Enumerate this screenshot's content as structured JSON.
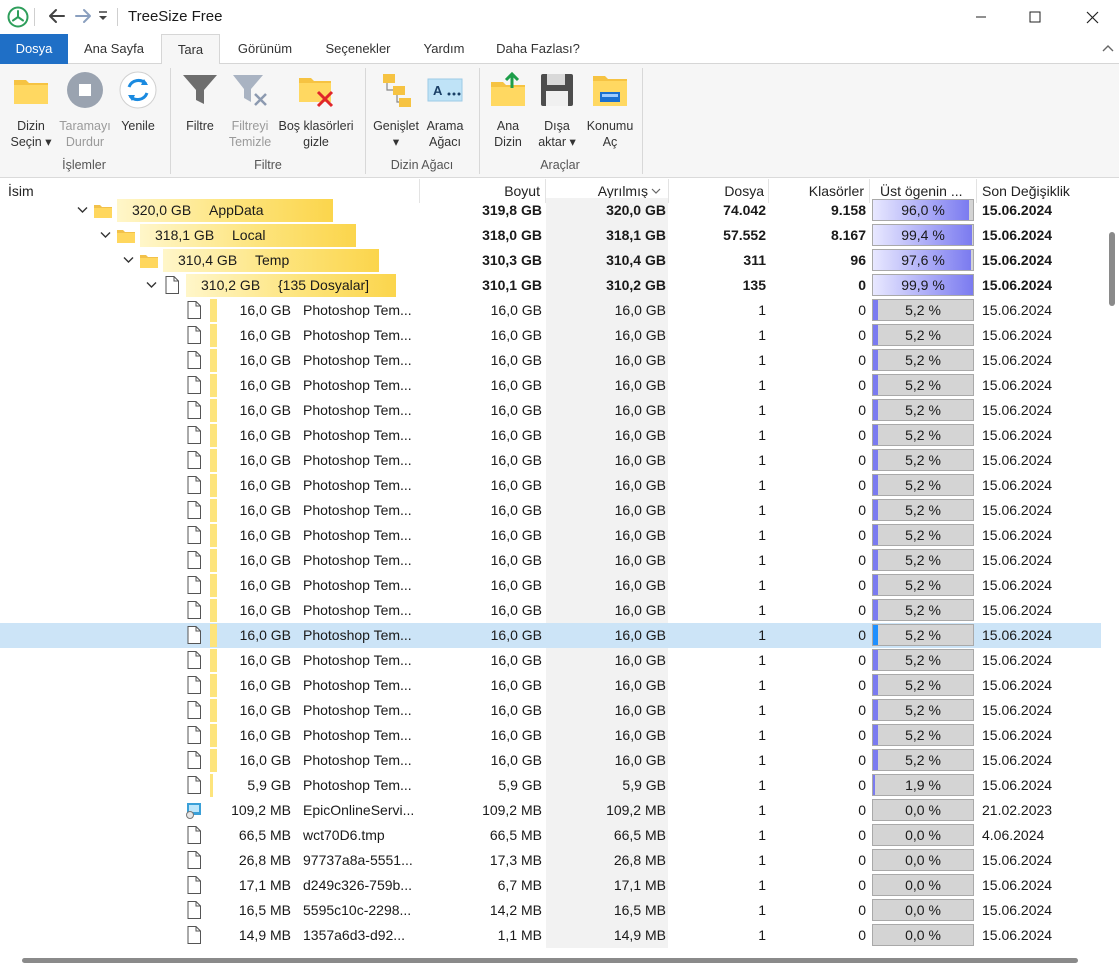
{
  "window": {
    "title": "TreeSize Free"
  },
  "ribbon_tabs": [
    "Dosya",
    "Ana Sayfa",
    "Tara",
    "Görünüm",
    "Seçenekler",
    "Yardım",
    "Daha Fazlası?"
  ],
  "ribbon": {
    "buttons": [
      {
        "label1": "Dizin",
        "label2": "Seçin ▾",
        "icon": "folder-open-icon"
      },
      {
        "label1": "Taramayı",
        "label2": "Durdur",
        "icon": "stop-icon"
      },
      {
        "label1": "Yenile",
        "label2": "",
        "icon": "refresh-icon"
      },
      {
        "label1": "Filtre",
        "label2": "",
        "icon": "filter-icon"
      },
      {
        "label1": "Filtreyi",
        "label2": "Temizle",
        "icon": "clear-filter-icon"
      },
      {
        "label1": "Boş klasörleri",
        "label2": "gizle",
        "icon": "hide-empty-folders-icon"
      },
      {
        "label1": "Genişlet",
        "label2": "▾",
        "icon": "expand-tree-icon"
      },
      {
        "label1": "Arama",
        "label2": "Ağacı",
        "icon": "search-tree-icon"
      },
      {
        "label1": "Ana",
        "label2": "Dizin",
        "icon": "parent-folder-icon"
      },
      {
        "label1": "Dışa",
        "label2": "aktar ▾",
        "icon": "save-export-icon"
      },
      {
        "label1": "Konumu",
        "label2": "Aç",
        "icon": "open-location-icon"
      }
    ],
    "groups": [
      "İşlemler",
      "Filtre",
      "Dizin Ağacı",
      "Araçlar"
    ]
  },
  "columns": [
    "İsim",
    "Boyut",
    "Ayrılmış",
    "Dosya",
    "Klasörler",
    "Üst ögenin ...",
    "Son Değişiklik"
  ],
  "colors": {
    "accent": "#1f6fc6",
    "folder_bar": "#fde47c",
    "percent_fill": "#7b7bf0",
    "percent_fill_selected": "#1e90ff",
    "selected_row": "#cce4f7"
  },
  "tree_rows": [
    {
      "name_size": "320,0 GB",
      "name": "AppData",
      "size": "319,8 GB",
      "alloc": "320,0 GB",
      "files": "74.042",
      "folders": "9.158",
      "pct": "96,0 %",
      "pct_value": 96.0,
      "date": "15.06.2024",
      "kind": "folder",
      "level": 0,
      "bold": true
    },
    {
      "name_size": "318,1 GB",
      "name": "Local",
      "size": "318,0 GB",
      "alloc": "318,1 GB",
      "files": "57.552",
      "folders": "8.167",
      "pct": "99,4 %",
      "pct_value": 99.4,
      "date": "15.06.2024",
      "kind": "folder",
      "level": 1,
      "bold": true
    },
    {
      "name_size": "310,4 GB",
      "name": "Temp",
      "size": "310,3 GB",
      "alloc": "310,4 GB",
      "files": "311",
      "folders": "96",
      "pct": "97,6 %",
      "pct_value": 97.6,
      "date": "15.06.2024",
      "kind": "folder",
      "level": 2,
      "bold": true
    },
    {
      "name_size": "310,2 GB",
      "name": "{135 Dosyalar]",
      "size": "310,1 GB",
      "alloc": "310,2 GB",
      "files": "135",
      "folders": "0",
      "pct": "99,9 %",
      "pct_value": 99.9,
      "date": "15.06.2024",
      "kind": "files-group",
      "level": 3,
      "bold": true
    }
  ],
  "file_rows": [
    {
      "name_size": "16,0 GB",
      "name": "Photoshop Tem...",
      "size": "16,0 GB",
      "alloc": "16,0 GB",
      "files": "1",
      "folders": "0",
      "pct": "5,2 %",
      "pct_value": 5.2,
      "date": "15.06.2024"
    },
    {
      "name_size": "16,0 GB",
      "name": "Photoshop Tem...",
      "size": "16,0 GB",
      "alloc": "16,0 GB",
      "files": "1",
      "folders": "0",
      "pct": "5,2 %",
      "pct_value": 5.2,
      "date": "15.06.2024"
    },
    {
      "name_size": "16,0 GB",
      "name": "Photoshop Tem...",
      "size": "16,0 GB",
      "alloc": "16,0 GB",
      "files": "1",
      "folders": "0",
      "pct": "5,2 %",
      "pct_value": 5.2,
      "date": "15.06.2024"
    },
    {
      "name_size": "16,0 GB",
      "name": "Photoshop Tem...",
      "size": "16,0 GB",
      "alloc": "16,0 GB",
      "files": "1",
      "folders": "0",
      "pct": "5,2 %",
      "pct_value": 5.2,
      "date": "15.06.2024"
    },
    {
      "name_size": "16,0 GB",
      "name": "Photoshop Tem...",
      "size": "16,0 GB",
      "alloc": "16,0 GB",
      "files": "1",
      "folders": "0",
      "pct": "5,2 %",
      "pct_value": 5.2,
      "date": "15.06.2024"
    },
    {
      "name_size": "16,0 GB",
      "name": "Photoshop Tem...",
      "size": "16,0 GB",
      "alloc": "16,0 GB",
      "files": "1",
      "folders": "0",
      "pct": "5,2 %",
      "pct_value": 5.2,
      "date": "15.06.2024"
    },
    {
      "name_size": "16,0 GB",
      "name": "Photoshop Tem...",
      "size": "16,0 GB",
      "alloc": "16,0 GB",
      "files": "1",
      "folders": "0",
      "pct": "5,2 %",
      "pct_value": 5.2,
      "date": "15.06.2024"
    },
    {
      "name_size": "16,0 GB",
      "name": "Photoshop Tem...",
      "size": "16,0 GB",
      "alloc": "16,0 GB",
      "files": "1",
      "folders": "0",
      "pct": "5,2 %",
      "pct_value": 5.2,
      "date": "15.06.2024"
    },
    {
      "name_size": "16,0 GB",
      "name": "Photoshop Tem...",
      "size": "16,0 GB",
      "alloc": "16,0 GB",
      "files": "1",
      "folders": "0",
      "pct": "5,2 %",
      "pct_value": 5.2,
      "date": "15.06.2024"
    },
    {
      "name_size": "16,0 GB",
      "name": "Photoshop Tem...",
      "size": "16,0 GB",
      "alloc": "16,0 GB",
      "files": "1",
      "folders": "0",
      "pct": "5,2 %",
      "pct_value": 5.2,
      "date": "15.06.2024"
    },
    {
      "name_size": "16,0 GB",
      "name": "Photoshop Tem...",
      "size": "16,0 GB",
      "alloc": "16,0 GB",
      "files": "1",
      "folders": "0",
      "pct": "5,2 %",
      "pct_value": 5.2,
      "date": "15.06.2024"
    },
    {
      "name_size": "16,0 GB",
      "name": "Photoshop Tem...",
      "size": "16,0 GB",
      "alloc": "16,0 GB",
      "files": "1",
      "folders": "0",
      "pct": "5,2 %",
      "pct_value": 5.2,
      "date": "15.06.2024"
    },
    {
      "name_size": "16,0 GB",
      "name": "Photoshop Tem...",
      "size": "16,0 GB",
      "alloc": "16,0 GB",
      "files": "1",
      "folders": "0",
      "pct": "5,2 %",
      "pct_value": 5.2,
      "date": "15.06.2024"
    },
    {
      "name_size": "16,0 GB",
      "name": "Photoshop Tem...",
      "size": "16,0 GB",
      "alloc": "16,0 GB",
      "files": "1",
      "folders": "0",
      "pct": "5,2 %",
      "pct_value": 5.2,
      "date": "15.06.2024",
      "selected": true
    },
    {
      "name_size": "16,0 GB",
      "name": "Photoshop Tem...",
      "size": "16,0 GB",
      "alloc": "16,0 GB",
      "files": "1",
      "folders": "0",
      "pct": "5,2 %",
      "pct_value": 5.2,
      "date": "15.06.2024"
    },
    {
      "name_size": "16,0 GB",
      "name": "Photoshop Tem...",
      "size": "16,0 GB",
      "alloc": "16,0 GB",
      "files": "1",
      "folders": "0",
      "pct": "5,2 %",
      "pct_value": 5.2,
      "date": "15.06.2024"
    },
    {
      "name_size": "16,0 GB",
      "name": "Photoshop Tem...",
      "size": "16,0 GB",
      "alloc": "16,0 GB",
      "files": "1",
      "folders": "0",
      "pct": "5,2 %",
      "pct_value": 5.2,
      "date": "15.06.2024"
    },
    {
      "name_size": "16,0 GB",
      "name": "Photoshop Tem...",
      "size": "16,0 GB",
      "alloc": "16,0 GB",
      "files": "1",
      "folders": "0",
      "pct": "5,2 %",
      "pct_value": 5.2,
      "date": "15.06.2024"
    },
    {
      "name_size": "16,0 GB",
      "name": "Photoshop Tem...",
      "size": "16,0 GB",
      "alloc": "16,0 GB",
      "files": "1",
      "folders": "0",
      "pct": "5,2 %",
      "pct_value": 5.2,
      "date": "15.06.2024"
    },
    {
      "name_size": "5,9 GB",
      "name": "Photoshop Tem...",
      "size": "5,9 GB",
      "alloc": "5,9 GB",
      "files": "1",
      "folders": "0",
      "pct": "1,9 %",
      "pct_value": 1.9,
      "date": "15.06.2024"
    },
    {
      "name_size": "109,2 MB",
      "name": "EpicOnlineServi...",
      "size": "109,2 MB",
      "alloc": "109,2 MB",
      "files": "1",
      "folders": "0",
      "pct": "0,0 %",
      "pct_value": 0.0,
      "date": "21.02.2023",
      "icon": "installer"
    },
    {
      "name_size": "66,5 MB",
      "name": "wct70D6.tmp",
      "size": "66,5 MB",
      "alloc": "66,5 MB",
      "files": "1",
      "folders": "0",
      "pct": "0,0 %",
      "pct_value": 0.0,
      "date": "4.06.2024"
    },
    {
      "name_size": "26,8 MB",
      "name": "97737a8a-5551...",
      "size": "17,3 MB",
      "alloc": "26,8 MB",
      "files": "1",
      "folders": "0",
      "pct": "0,0 %",
      "pct_value": 0.0,
      "date": "15.06.2024"
    },
    {
      "name_size": "17,1 MB",
      "name": "d249c326-759b...",
      "size": "6,7 MB",
      "alloc": "17,1 MB",
      "files": "1",
      "folders": "0",
      "pct": "0,0 %",
      "pct_value": 0.0,
      "date": "15.06.2024"
    },
    {
      "name_size": "16,5 MB",
      "name": "5595c10c-2298...",
      "size": "14,2 MB",
      "alloc": "16,5 MB",
      "files": "1",
      "folders": "0",
      "pct": "0,0 %",
      "pct_value": 0.0,
      "date": "15.06.2024"
    },
    {
      "name_size": "14,9 MB",
      "name": "1357a6d3-d92...",
      "size": "1,1 MB",
      "alloc": "14,9 MB",
      "files": "1",
      "folders": "0",
      "pct": "0,0 %",
      "pct_value": 0.0,
      "date": "15.06.2024"
    }
  ]
}
